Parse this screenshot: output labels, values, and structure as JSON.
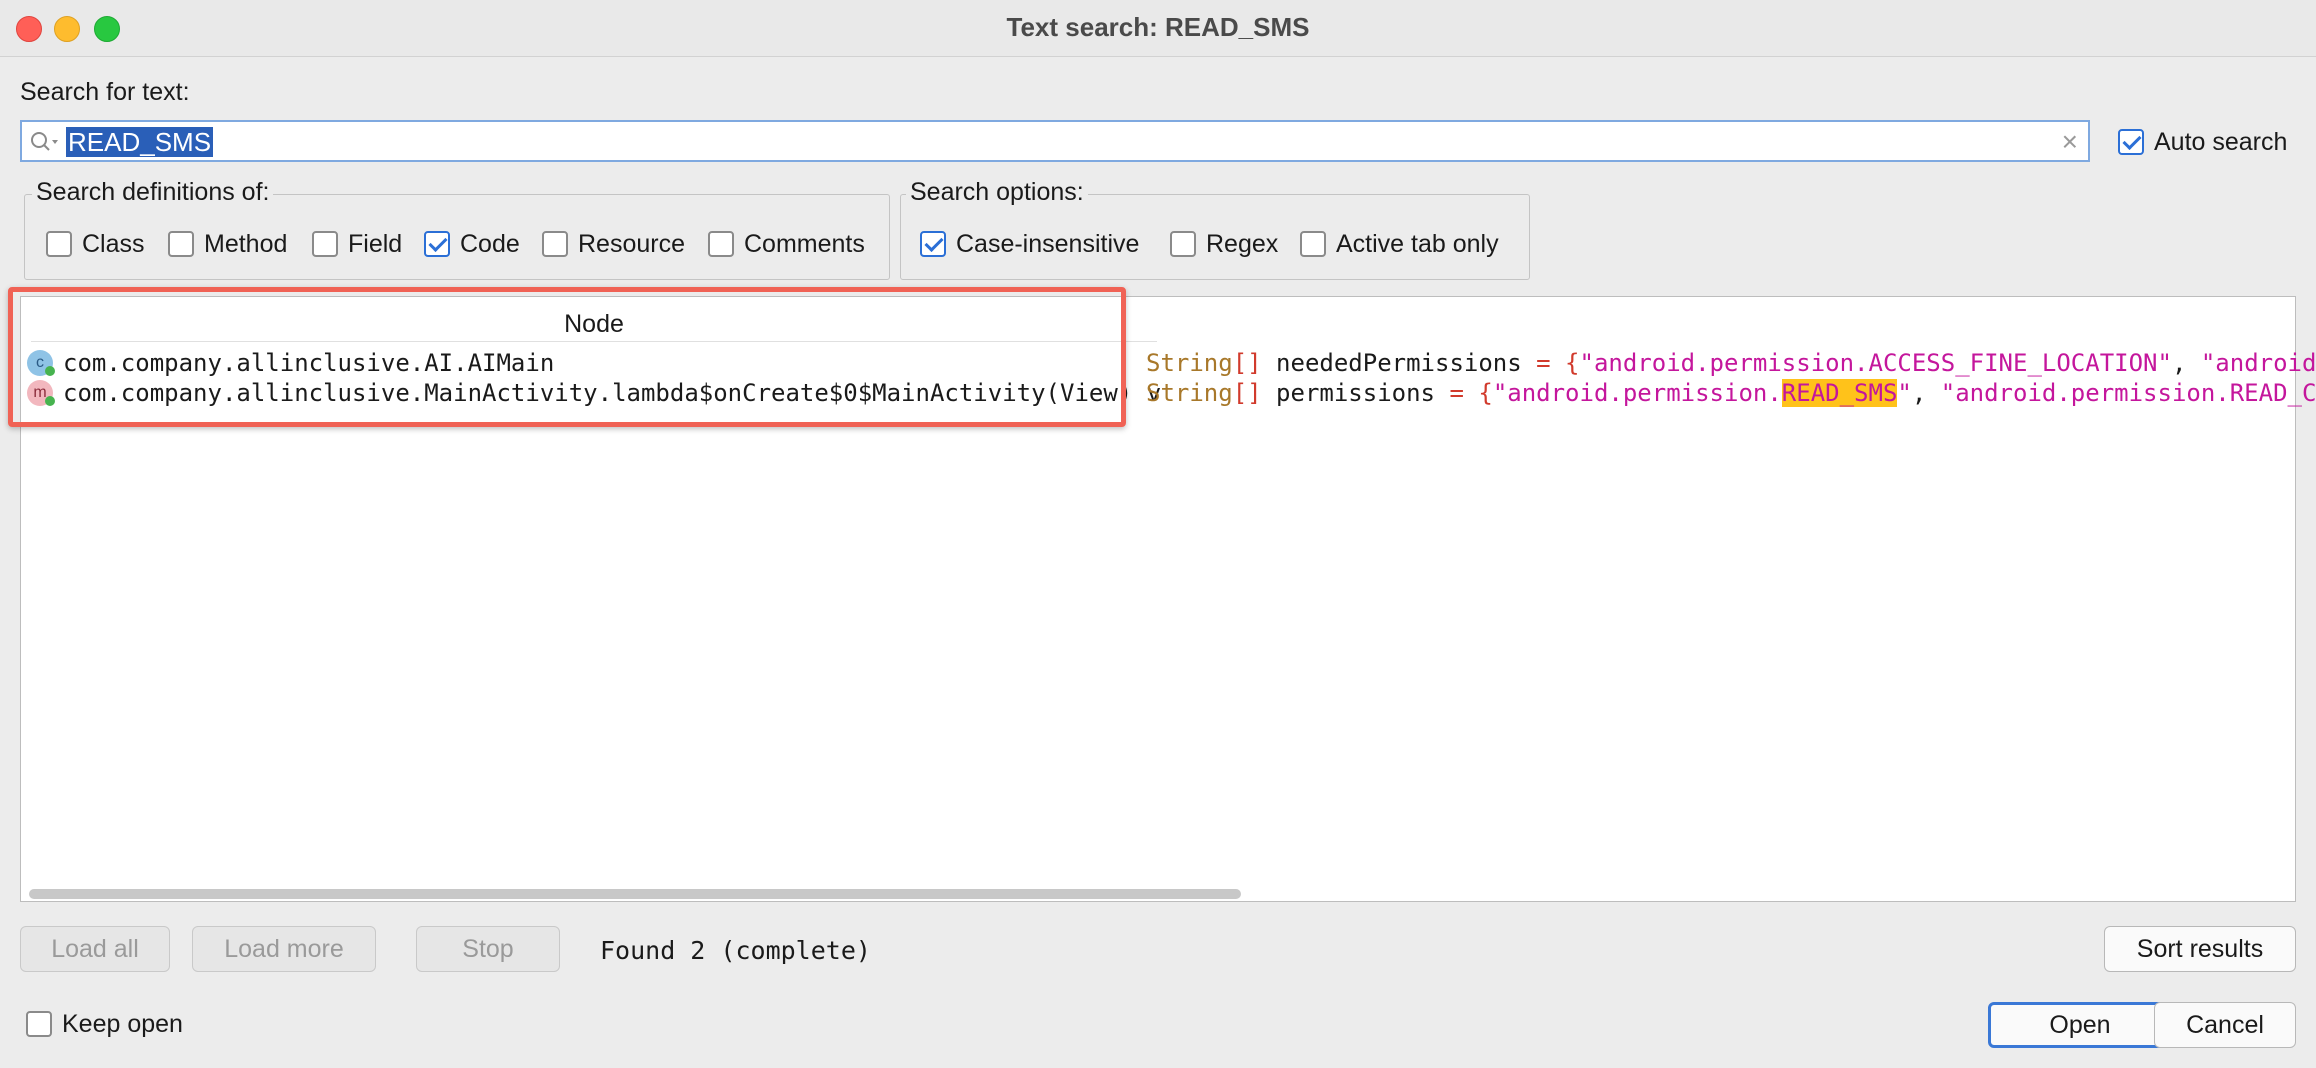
{
  "window": {
    "title": "Text search: READ_SMS"
  },
  "search": {
    "label": "Search for text:",
    "value": "READ_SMS",
    "clear_glyph": "×",
    "auto_search": {
      "label": "Auto search",
      "checked": true
    }
  },
  "definitions": {
    "title": "Search definitions of:",
    "items": [
      {
        "label": "Class",
        "checked": false
      },
      {
        "label": "Method",
        "checked": false
      },
      {
        "label": "Field",
        "checked": false
      },
      {
        "label": "Code",
        "checked": true
      },
      {
        "label": "Resource",
        "checked": false
      },
      {
        "label": "Comments",
        "checked": false
      }
    ]
  },
  "options": {
    "title": "Search options:",
    "items": [
      {
        "label": "Case-insensitive",
        "checked": true
      },
      {
        "label": "Regex",
        "checked": false
      },
      {
        "label": "Active tab only",
        "checked": false
      }
    ]
  },
  "results": {
    "column_header": "Node",
    "rows": [
      {
        "icon": "class-icon",
        "icon_letter": "c",
        "node": "com.company.allinclusive.AI.AIMain",
        "code": {
          "type": "String",
          "brackets": "[]",
          "name": " neededPermissions ",
          "op": "= {",
          "str_pre": "\"android.permission.ACCESS_FINE_LOCATION\"",
          "highlight": "",
          "str_post": "",
          "tail": ", ",
          "tail_str": "\"android."
        }
      },
      {
        "icon": "method-icon",
        "icon_letter": "m",
        "node": "com.company.allinclusive.MainActivity.lambda$onCreate$0$MainActivity(View) v",
        "code": {
          "type": "String",
          "brackets": "[]",
          "name": " permissions ",
          "op": "= {",
          "str_pre": "\"android.permission.",
          "highlight": "READ_SMS",
          "str_post": "\"",
          "tail": ", ",
          "tail_str": "\"android.permission.READ_CO"
        }
      }
    ]
  },
  "footer": {
    "load_all": "Load all",
    "load_more": "Load more",
    "stop": "Stop",
    "status": "Found 2 (complete)",
    "sort_results": "Sort results",
    "keep_open": {
      "label": "Keep open",
      "checked": false
    },
    "open": "Open",
    "cancel": "Cancel"
  },
  "colors": {
    "accent": "#2b6fd6",
    "highlight_box": "#f06255",
    "match_highlight": "#ffc21a"
  }
}
